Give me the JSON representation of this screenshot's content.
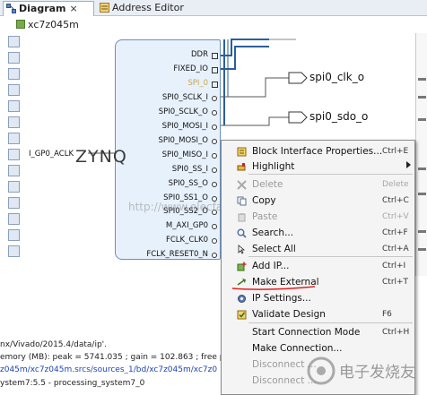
{
  "tabs": [
    {
      "label": "Diagram",
      "close": "×"
    },
    {
      "label": "Address Editor",
      "close": "×"
    }
  ],
  "breadcrumb": "xc7z045m",
  "block": {
    "ports": [
      "DDR",
      "FIXED_IO",
      "SPI_0",
      "SPI0_SCLK_I",
      "SPI0_SCLK_O",
      "SPI0_MOSI_I",
      "SPI0_MOSI_O",
      "SPI0_MISO_I",
      "SPI0_SS_I",
      "SPI0_SS_O",
      "SPI0_SS1_O",
      "SPI0_SS2_O",
      "M_AXI_GP0",
      "FCLK_CLK0",
      "FCLK_RESET0_N"
    ],
    "left_port": "I_GP0_ACLK",
    "logo": "ZYNQ"
  },
  "nets": [
    "spi0_clk_o",
    "spi0_sdo_o"
  ],
  "watermark": "http://www.elecfans.com",
  "menu": {
    "items": [
      {
        "label": "Block Interface Properties...",
        "shortcut": "Ctrl+E",
        "enabled": true,
        "icon": "properties-icon"
      },
      {
        "label": "Highlight",
        "shortcut": "",
        "enabled": true,
        "icon": "highlight-icon",
        "submenu": true
      },
      {
        "label": "Delete",
        "shortcut": "Delete",
        "enabled": false,
        "icon": "delete-icon"
      },
      {
        "label": "Copy",
        "shortcut": "Ctrl+C",
        "enabled": true,
        "icon": "copy-icon"
      },
      {
        "label": "Paste",
        "shortcut": "Ctrl+V",
        "enabled": false,
        "icon": "paste-icon"
      },
      {
        "label": "Search...",
        "shortcut": "Ctrl+F",
        "enabled": true,
        "icon": "search-icon"
      },
      {
        "label": "Select All",
        "shortcut": "Ctrl+A",
        "enabled": true,
        "icon": "select-all-icon"
      },
      {
        "label": "Add IP...",
        "shortcut": "Ctrl+I",
        "enabled": true,
        "icon": "add-ip-icon"
      },
      {
        "label": "Make External",
        "shortcut": "Ctrl+T",
        "enabled": true,
        "icon": "make-external-icon"
      },
      {
        "label": "IP Settings...",
        "shortcut": "",
        "enabled": true,
        "icon": "ip-settings-icon"
      },
      {
        "label": "Validate Design",
        "shortcut": "F6",
        "enabled": true,
        "icon": "validate-icon"
      },
      {
        "label": "Start Connection Mode",
        "shortcut": "Ctrl+H",
        "enabled": true,
        "icon": ""
      },
      {
        "label": "Make Connection...",
        "shortcut": "",
        "enabled": true,
        "icon": ""
      },
      {
        "label": "Disconnect ...",
        "shortcut": "",
        "enabled": false,
        "icon": ""
      },
      {
        "label": "Disconnect ...",
        "shortcut": "",
        "enabled": false,
        "icon": ""
      }
    ]
  },
  "console": {
    "lines": [
      "nx/Vivado/2015.4/data/ip'.",
      "emory (MB): peak = 5741.035 ; gain = 102.863 ; free ph",
      "z045m/xc7z045m.srcs/sources_1/bd/xc7z045m/xc7z0",
      "ystem7:5.5 - processing_system7_0"
    ]
  },
  "watermark_logo": "电子发烧友",
  "colors": {
    "bus": "#2a5f9c",
    "block_fill": "#e7f1fb",
    "annotation": "#e02020"
  }
}
